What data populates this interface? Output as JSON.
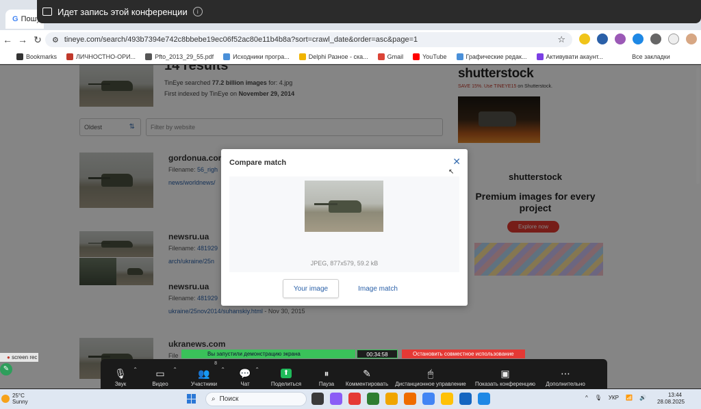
{
  "recording_banner": {
    "text": "Идет запись этой конференции"
  },
  "browser": {
    "tab_label": "Пошу",
    "url": "tineye.com/search/493b7394e742c8bbebe19ec06f52ac80e11b4b8a?sort=crawl_date&order=asc&page=1",
    "bookmarks": [
      {
        "label": "Bookmarks",
        "color": "#333333"
      },
      {
        "label": "ЛИЧНОСТНО-ОРИ...",
        "color": "#c0392b"
      },
      {
        "label": "Pfto_2013_29_55.pdf",
        "color": "#555555"
      },
      {
        "label": "Исходники програ...",
        "color": "#4a90d9"
      },
      {
        "label": "Delphi Разное - ска...",
        "color": "#f0b400"
      },
      {
        "label": "Gmail",
        "color": "#db4437"
      },
      {
        "label": "YouTube",
        "color": "#ff0000"
      },
      {
        "label": "Графические редак...",
        "color": "#4a90d9"
      },
      {
        "label": "Активувати акаунт...",
        "color": "#7b3fe4"
      }
    ],
    "all_bookmarks": "Все закладки"
  },
  "tineye": {
    "results_title": "14 results",
    "searched_prefix": "TinEye searched ",
    "searched_count": "77.2 billion images",
    "searched_for": " for: 4.jpg",
    "first_indexed_prefix": "First indexed by TinEye on ",
    "first_indexed_date": "November 29, 2014",
    "sort_value": "Oldest",
    "filter_placeholder": "Filter by website",
    "results": [
      {
        "domain": "gordonua.com",
        "filename_label": "Filename: ",
        "filename": "56_righ",
        "link": "news/worldnews/",
        "date": ""
      },
      {
        "domain": "newsru.ua",
        "filename_label": "Filename: ",
        "filename": "481929",
        "link": "arch/ukraine/25n",
        "date": ""
      },
      {
        "domain": "newsru.ua",
        "filename_label": "Filename: ",
        "filename": "481929",
        "link": "ukraine/25nov2014/suhanskiy.html",
        "date": " - Nov 30, 2015"
      },
      {
        "domain": "ukranews.com",
        "filename_label": "File",
        "filename": "",
        "link": "",
        "date": ""
      }
    ]
  },
  "shutterstock": {
    "logo": "shutterstock",
    "promo_pre": "SAVE 15%. Use ",
    "promo_code": "TINEYE15",
    "promo_post": " on Shutterstock.",
    "ad_logo": "shutterstock",
    "ad_heading": "Premium images for every project",
    "ad_button": "Explore now"
  },
  "modal": {
    "title": "Compare match",
    "close": "✕",
    "caption": "JPEG, 877x579, 59.2 kB",
    "tab_your_image": "Your image",
    "tab_image_match": "Image match"
  },
  "screenrec": {
    "text": "screen rec"
  },
  "share": {
    "banner": "Вы запустили демонстрацию экрана",
    "timer": "00:34:58",
    "stop": "Остановить совместное использование"
  },
  "zoom_toolbar": {
    "items": [
      {
        "label": "Звук",
        "icon": "🎙"
      },
      {
        "label": "Видео",
        "icon": "▭"
      },
      {
        "label": "Участники",
        "icon": "👥"
      },
      {
        "label": "Чат",
        "icon": "💬"
      },
      {
        "label": "Поделиться",
        "icon": "⬆"
      },
      {
        "label": "Пауза",
        "icon": "⏸"
      },
      {
        "label": "Комментировать",
        "icon": "✎"
      },
      {
        "label": "Дистанционное управление",
        "icon": "🖱"
      },
      {
        "label": "Показать конференцию",
        "icon": "▣"
      },
      {
        "label": "Дополнительно",
        "icon": "⋯"
      }
    ],
    "participants_count": "8"
  },
  "taskbar": {
    "temp": "25°C",
    "weather": "Sunny",
    "search_placeholder": "Поиск",
    "lang": "УКР",
    "time": "13:44",
    "date": "28.08.2025",
    "app_colors": [
      "#3a3a3a",
      "#8b5cf6",
      "#e53935",
      "#2e7d32",
      "#f0a500",
      "#ef6c00",
      "#4285f4",
      "#ffc107",
      "#1565c0",
      "#1e88e5"
    ]
  }
}
